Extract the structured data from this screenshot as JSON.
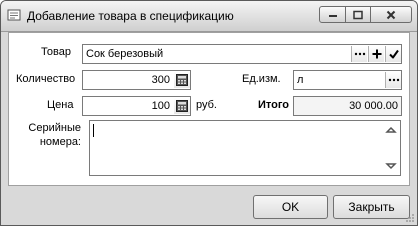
{
  "window": {
    "title": "Добавление товара в спецификацию"
  },
  "form": {
    "product_label": "Товар",
    "product_value": "Сок березовый",
    "quantity_label": "Количество",
    "quantity_value": "300",
    "unit_label": "Ед.изм.",
    "unit_value": "л",
    "price_label": "Цена",
    "price_value": "100",
    "currency_label": "руб.",
    "total_label": "Итого",
    "total_value": "30 000.00",
    "serials_label_line1": "Серийные",
    "serials_label_line2": "номера:",
    "serials_value": ""
  },
  "footer": {
    "ok_label": "OK",
    "close_label": "Закрыть"
  }
}
